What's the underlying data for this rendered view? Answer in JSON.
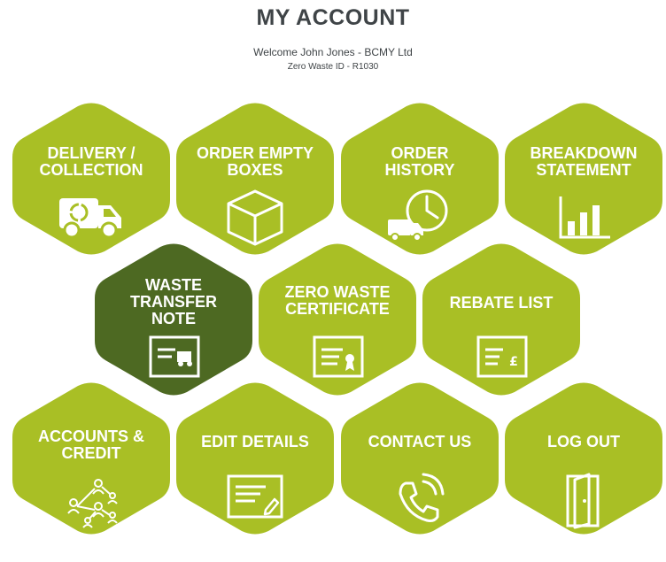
{
  "header": {
    "title": "MY ACCOUNT",
    "welcome": "Welcome John Jones - BCMY Ltd",
    "zero_waste_id": "Zero Waste ID - R1030"
  },
  "colors": {
    "tile": "#a9bf25",
    "tile_active": "#4d6922",
    "text": "#3f4447"
  },
  "tiles": [
    {
      "label1": "DELIVERY /",
      "label2": "COLLECTION",
      "label3": "",
      "icon": "recycling-van-icon"
    },
    {
      "label1": "ORDER EMPTY",
      "label2": "BOXES",
      "label3": "",
      "icon": "box-icon"
    },
    {
      "label1": "ORDER",
      "label2": "HISTORY",
      "label3": "",
      "icon": "clock-van-icon"
    },
    {
      "label1": "BREAKDOWN",
      "label2": "STATEMENT",
      "label3": "",
      "icon": "bar-chart-icon"
    },
    {
      "label1": "WASTE",
      "label2": "TRANSFER",
      "label3": "NOTE",
      "icon": "transfer-note-icon"
    },
    {
      "label1": "ZERO WASTE",
      "label2": "CERTIFICATE",
      "label3": "",
      "icon": "certificate-icon"
    },
    {
      "label1": "REBATE LIST",
      "label2": "",
      "label3": "",
      "icon": "rebate-document-icon"
    },
    {
      "label1": "ACCOUNTS &",
      "label2": "CREDIT",
      "label3": "",
      "icon": "network-people-icon"
    },
    {
      "label1": "EDIT DETAILS",
      "label2": "",
      "label3": "",
      "icon": "edit-document-icon"
    },
    {
      "label1": "CONTACT US",
      "label2": "",
      "label3": "",
      "icon": "phone-icon"
    },
    {
      "label1": "LOG OUT",
      "label2": "",
      "label3": "",
      "icon": "door-icon"
    }
  ]
}
